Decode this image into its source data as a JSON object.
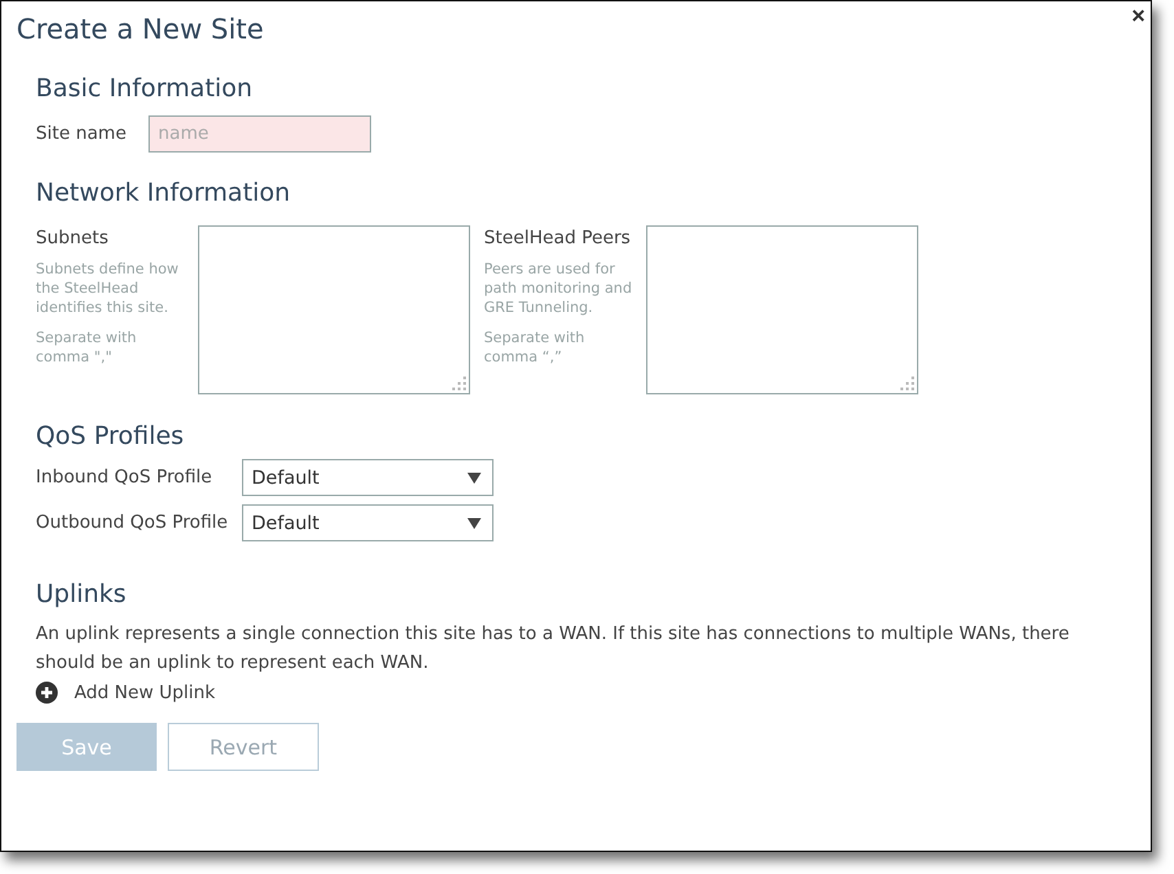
{
  "dialog": {
    "title": "Create a New Site",
    "close": "×"
  },
  "basic": {
    "heading": "Basic Information",
    "site_name": {
      "label": "Site name",
      "placeholder": "name",
      "invalid": true
    }
  },
  "network": {
    "heading": "Network Information",
    "fields": [
      {
        "label": "Subnets",
        "help": [
          "Subnets define how the SteelHead identifies this site.",
          "Separate with comma \",\""
        ]
      },
      {
        "label": "SteelHead Peers",
        "help": [
          "Peers are used for path monitoring and GRE Tunneling.",
          "Separate with comma “,”"
        ]
      }
    ]
  },
  "qos": {
    "heading": "QoS Profiles",
    "selects": [
      {
        "label": "Inbound QoS Profile",
        "value": "Default"
      },
      {
        "label": "Outbound QoS Profile",
        "value": "Default"
      }
    ]
  },
  "uplinks": {
    "heading": "Uplinks",
    "description": "An uplink represents a single connection this site has to a WAN. If this site has connections to multiple WANs, there should be an uplink to represent each WAN.",
    "add": "Add New Uplink"
  },
  "buttons": [
    {
      "label": "Save",
      "kind": "primary",
      "disabled": true
    },
    {
      "label": "Revert",
      "kind": "secondary",
      "disabled": true
    }
  ]
}
